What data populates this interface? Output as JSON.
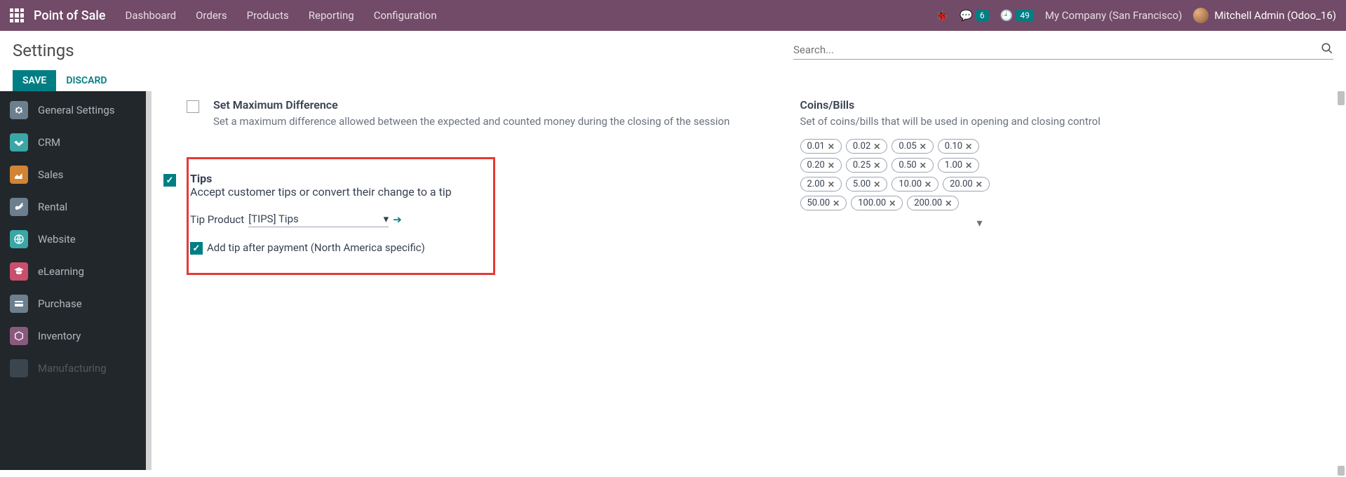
{
  "topbar": {
    "brand": "Point of Sale",
    "menu": [
      "Dashboard",
      "Orders",
      "Products",
      "Reporting",
      "Configuration"
    ],
    "chat_badge": "6",
    "clock_badge": "49",
    "company": "My Company (San Francisco)",
    "user": "Mitchell Admin (Odoo_16)"
  },
  "header": {
    "title": "Settings",
    "save": "SAVE",
    "discard": "DISCARD",
    "search_placeholder": "Search..."
  },
  "sidebar": [
    {
      "label": "General Settings",
      "color": "#6b7f8e"
    },
    {
      "label": "CRM",
      "color": "#3aa6a6"
    },
    {
      "label": "Sales",
      "color": "#d08434"
    },
    {
      "label": "Rental",
      "color": "#6b7f8e"
    },
    {
      "label": "Website",
      "color": "#3aa6a6"
    },
    {
      "label": "eLearning",
      "color": "#c94f6d"
    },
    {
      "label": "Purchase",
      "color": "#6b7f8e"
    },
    {
      "label": "Inventory",
      "color": "#8a5a7e"
    },
    {
      "label": "Manufacturing",
      "color": "#6b7f8e"
    }
  ],
  "maxdiff": {
    "title": "Set Maximum Difference",
    "desc": "Set a maximum difference allowed between the expected and counted money during the closing of the session"
  },
  "coins": {
    "title": "Coins/Bills",
    "desc": "Set of coins/bills that will be used in opening and closing control",
    "items": [
      "0.01",
      "0.02",
      "0.05",
      "0.10",
      "0.20",
      "0.25",
      "0.50",
      "1.00",
      "2.00",
      "5.00",
      "10.00",
      "20.00",
      "50.00",
      "100.00",
      "200.00"
    ]
  },
  "tips": {
    "title": "Tips",
    "desc": "Accept customer tips or convert their change to a tip",
    "product_label": "Tip Product",
    "product_value": "[TIPS] Tips",
    "after_payment": "Add tip after payment (North America specific)"
  }
}
